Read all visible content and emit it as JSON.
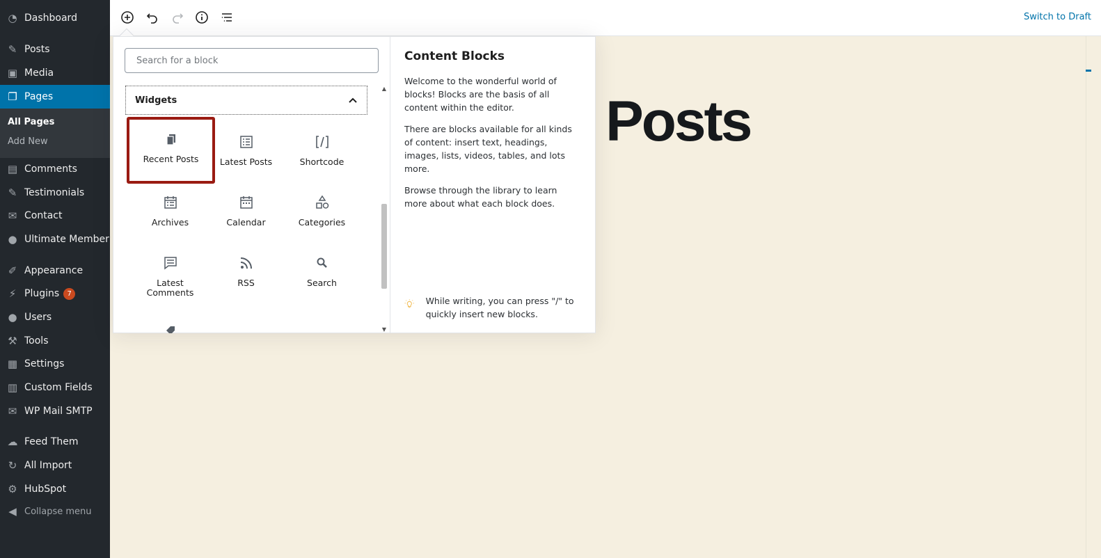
{
  "sidebar": {
    "items": [
      {
        "label": "Dashboard",
        "icon": "dashboard-icon"
      },
      {
        "label": "Posts",
        "icon": "pin-icon"
      },
      {
        "label": "Media",
        "icon": "media-icon"
      },
      {
        "label": "Pages",
        "icon": "pages-icon"
      },
      {
        "label": "Comments",
        "icon": "comment-icon"
      },
      {
        "label": "Testimonials",
        "icon": "pin-icon"
      },
      {
        "label": "Contact",
        "icon": "mail-icon"
      },
      {
        "label": "Ultimate Member",
        "icon": "user-icon"
      },
      {
        "label": "Appearance",
        "icon": "brush-icon"
      },
      {
        "label": "Plugins",
        "icon": "plug-icon",
        "badge": "7"
      },
      {
        "label": "Users",
        "icon": "user-icon"
      },
      {
        "label": "Tools",
        "icon": "wrench-icon"
      },
      {
        "label": "Settings",
        "icon": "settings-icon"
      },
      {
        "label": "Custom Fields",
        "icon": "table-icon"
      },
      {
        "label": "WP Mail SMTP",
        "icon": "mail-icon"
      },
      {
        "label": "Feed Them",
        "icon": "feed-icon"
      },
      {
        "label": "All Import",
        "icon": "import-icon"
      },
      {
        "label": "HubSpot",
        "icon": "gear-icon"
      }
    ],
    "submenu": {
      "all_pages": "All Pages",
      "add_new": "Add New"
    },
    "collapse": "Collapse menu"
  },
  "toolbar": {
    "switch_to_draft": "Switch to Draft"
  },
  "editor": {
    "title_fragment": "t Posts"
  },
  "inserter": {
    "search_placeholder": "Search for a block",
    "panel_title": "Widgets",
    "blocks": [
      {
        "label": "Recent Posts",
        "icon": "copy-icon"
      },
      {
        "label": "Latest Posts",
        "icon": "list-icon"
      },
      {
        "label": "Shortcode",
        "icon": "shortcode-icon"
      },
      {
        "label": "Archives",
        "icon": "archive-calendar-icon"
      },
      {
        "label": "Calendar",
        "icon": "calendar-icon"
      },
      {
        "label": "Categories",
        "icon": "shapes-icon"
      },
      {
        "label": "Latest Comments",
        "icon": "comment-icon"
      },
      {
        "label": "RSS",
        "icon": "rss-icon"
      },
      {
        "label": "Search",
        "icon": "search-icon"
      }
    ],
    "help": {
      "title": "Content Blocks",
      "p1": "Welcome to the wonderful world of blocks! Blocks are the basis of all content within the editor.",
      "p2": "There are blocks available for all kinds of content: insert text, headings, images, lists, videos, tables, and lots more.",
      "p3": "Browse through the library to learn more about what each block does.",
      "tip": "While writing, you can press \"/\" to quickly insert new blocks."
    }
  }
}
